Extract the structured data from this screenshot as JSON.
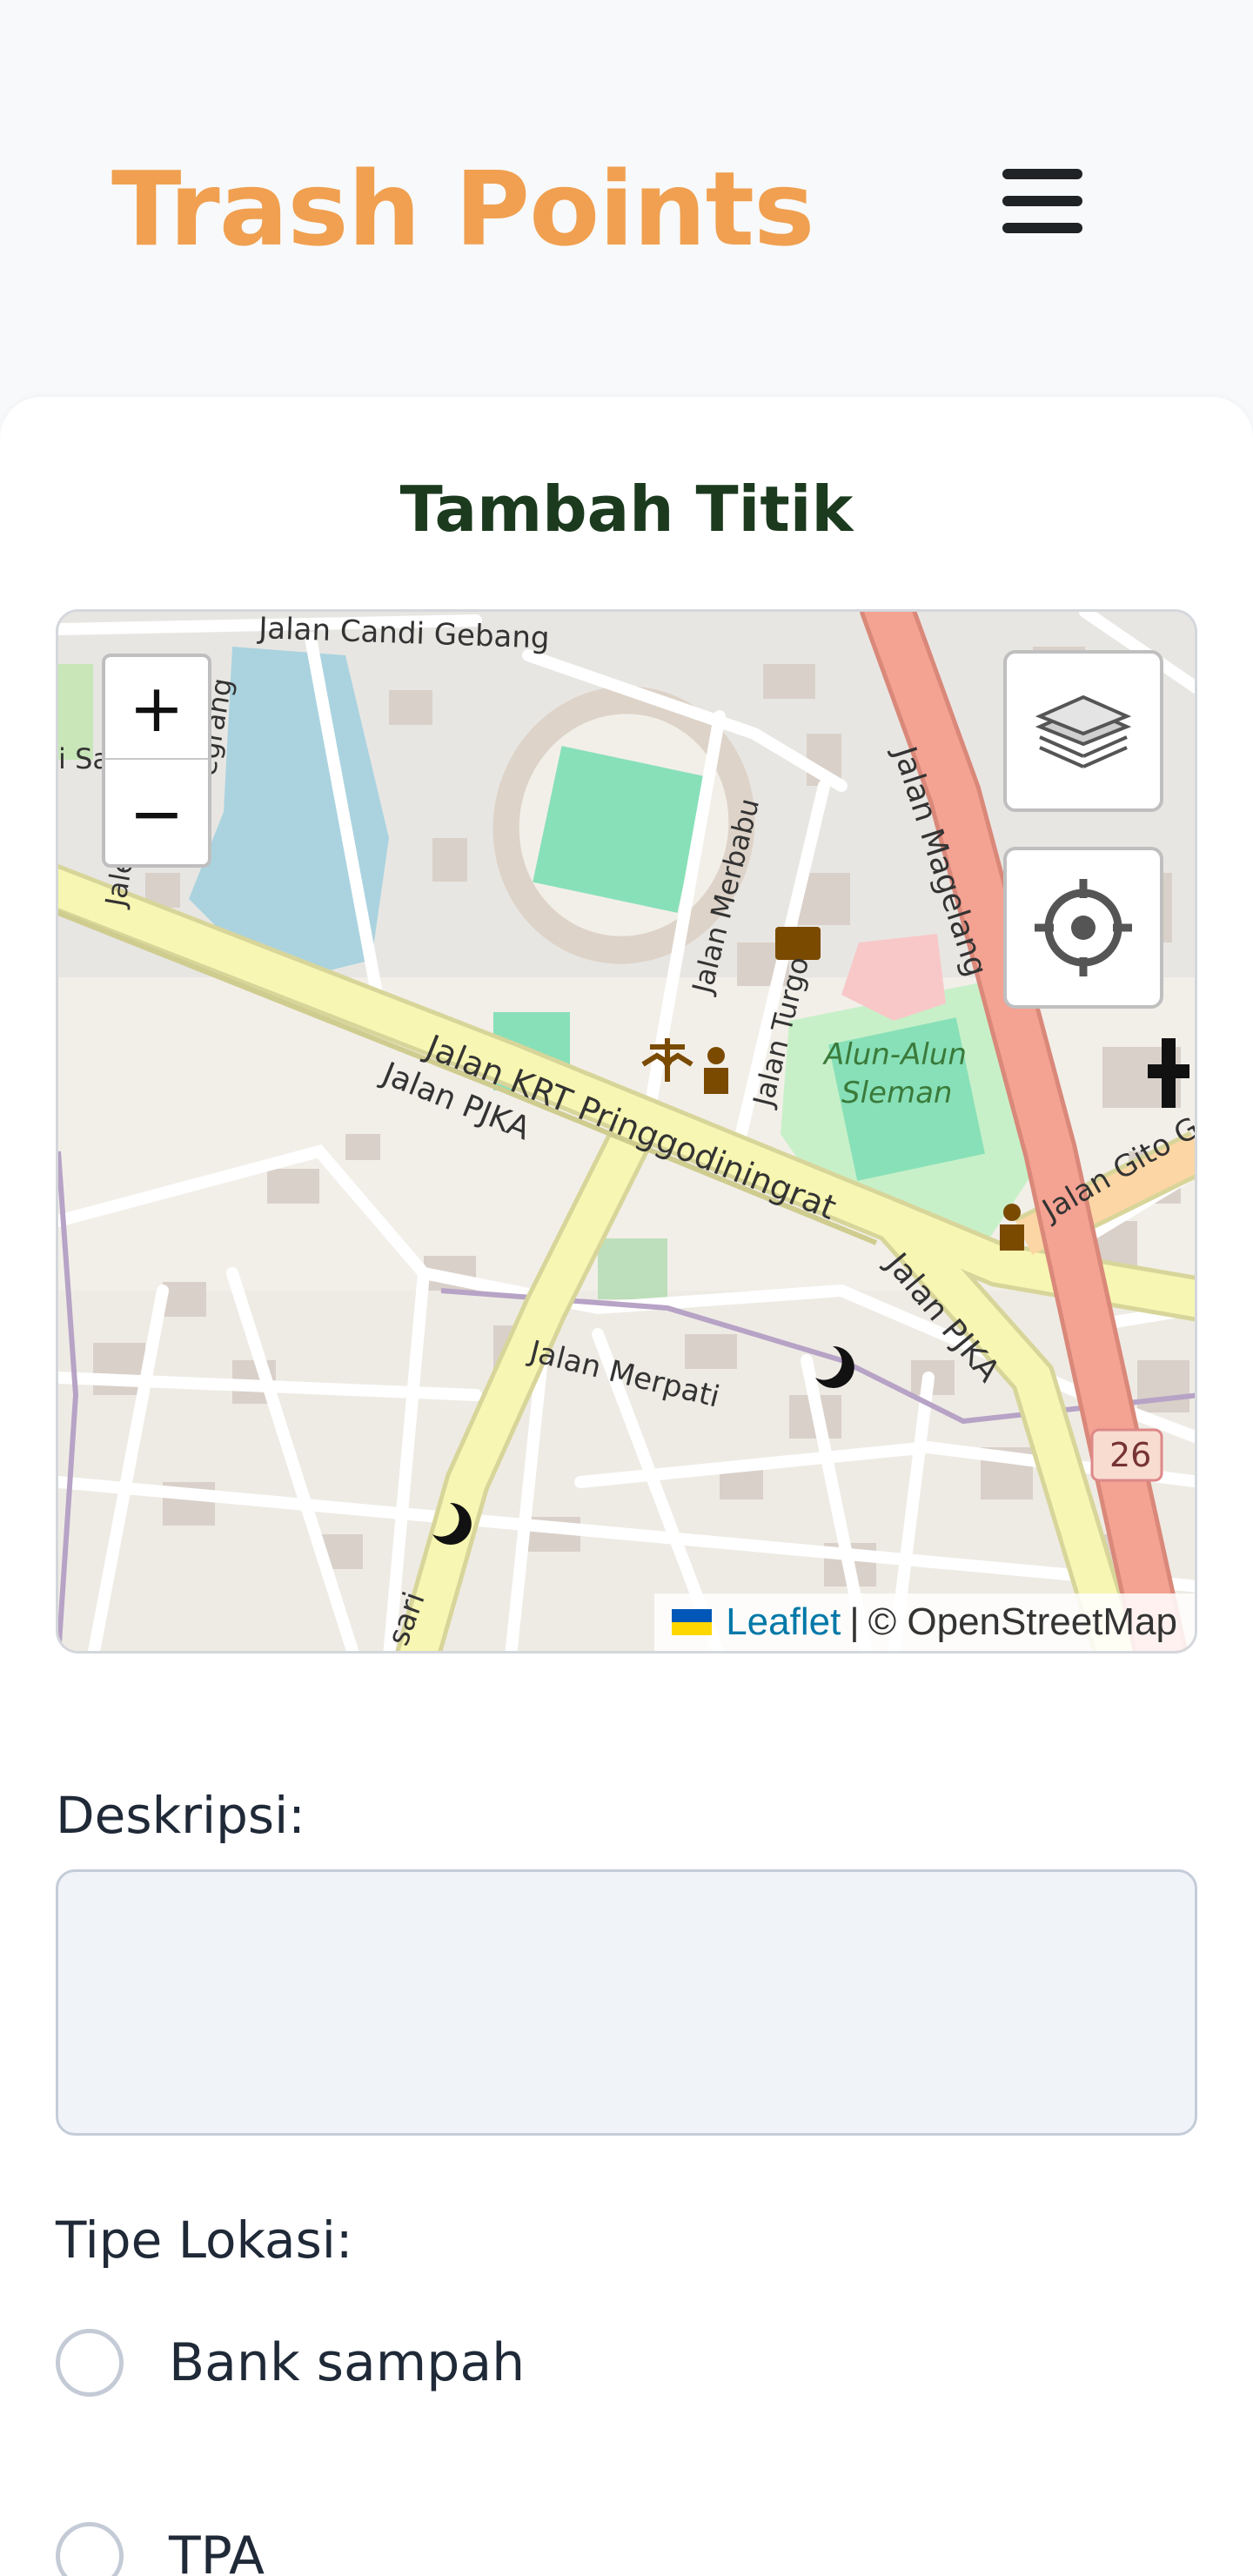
{
  "app": {
    "title": "Trash Points"
  },
  "header": {
    "menu_icon": "hamburger-menu-icon"
  },
  "form": {
    "title": "Tambah Titik",
    "description_label": "Deskripsi:",
    "description_value": "",
    "location_type_label": "Tipe Lokasi:",
    "location_types": [
      "Bank sampah",
      "TPA"
    ]
  },
  "map": {
    "zoom_in": "+",
    "zoom_out": "−",
    "layers_icon": "layers-icon",
    "locate_icon": "crosshair-locate-icon",
    "attribution": {
      "leaflet": "Leaflet",
      "separator": "|",
      "osm": "© OpenStreetMap"
    },
    "street_labels": {
      "candi_gebang": "Jalan Candi Gebang",
      "magelang": "Jalan Magelang",
      "merbabu": "Jalan Merbabu",
      "turgo": "Jalan Turgo",
      "krt": "Jalan KRT Pringgodiningrat",
      "pjka": "Jalan PJKA",
      "pjka2": "Jalan PJKA",
      "merpati": "Jalan Merpati",
      "gito": "Jalan Gito G",
      "alun1": "Alun-Alun",
      "alun2": "Sleman",
      "road_number": "26",
      "sari": "sari",
      "left1": "i Sa",
      "left2": "Jale",
      "left3": "egrang"
    }
  },
  "colors": {
    "brand": "#f0a050",
    "title": "#1b3a1e",
    "primary_road": "#e8a090",
    "secondary_road": "#f7f6b2",
    "stadium": "#88e0b8",
    "water": "#aad3df",
    "park": "#c8f0c8"
  }
}
